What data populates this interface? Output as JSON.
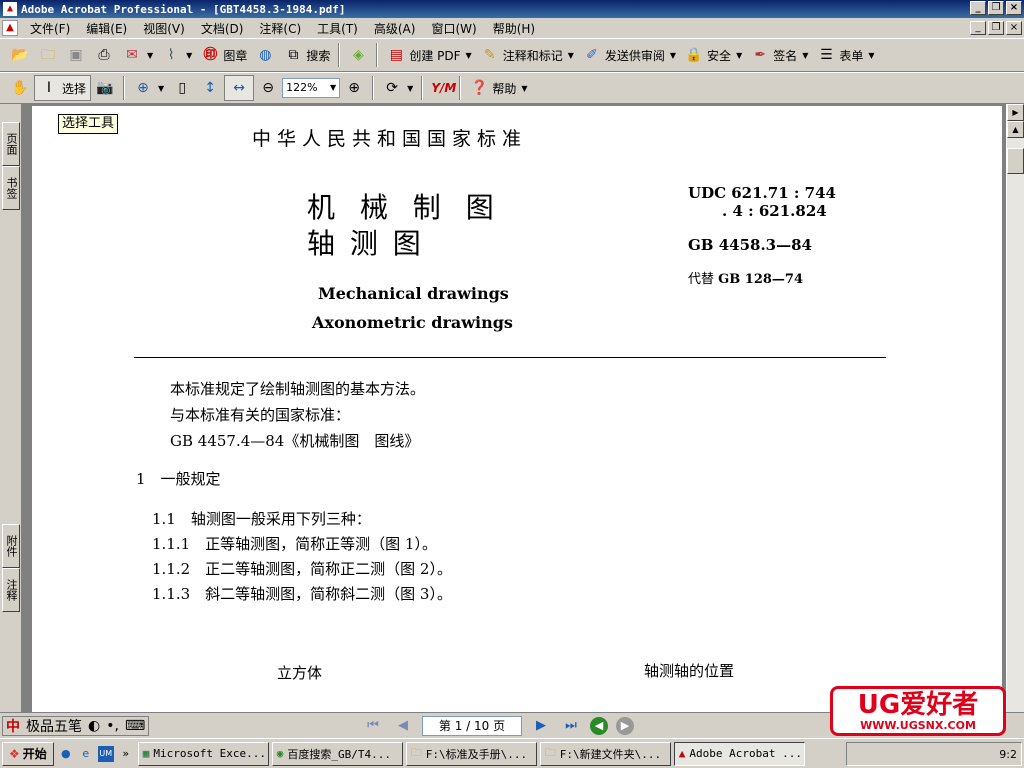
{
  "window": {
    "title": "Adobe Acrobat Professional - [GBT4458.3-1984.pdf]"
  },
  "menu": [
    "文件(F)",
    "编辑(E)",
    "视图(V)",
    "文档(D)",
    "注释(C)",
    "工具(T)",
    "高级(A)",
    "窗口(W)",
    "帮助(H)"
  ],
  "toolbar1": {
    "stamp": "图章",
    "search": "搜索",
    "create_pdf": "创建 PDF",
    "comment": "注释和标记",
    "review": "发送供审阅",
    "security": "安全",
    "sign": "签名",
    "forms": "表单"
  },
  "toolbar2": {
    "select": "选择",
    "zoom": "122%",
    "help": "帮助"
  },
  "left_tabs": {
    "pages": "页面",
    "bookmarks": "书签",
    "attachments": "附件",
    "comments": "注释"
  },
  "tooltip": "选择工具",
  "document": {
    "header": "中华人民共和国国家标准",
    "title1": "机 械 制 图",
    "title2": "轴     测     图",
    "en_title1": "Mechanical drawings",
    "en_title2": "Axonometric drawings",
    "udc1": "UDC 621.71 : 744",
    "udc2": ". 4 : 621.824",
    "gb": "GB 4458.3—84",
    "replace_prefix": "代替",
    "replace_code": "GB 128—74",
    "intro1": "本标准规定了绘制轴测图的基本方法。",
    "intro2": "与本标准有关的国家标准：",
    "intro3": "GB 4457.4—84《机械制图　图线》",
    "s1": "1　一般规定",
    "s11": "1.1　轴测图一般采用下列三种：",
    "s111": "1.1.1　正等轴测图，简称正等测（图 1）。",
    "s112": "1.1.2　正二等轴测图，简称正二测（图 2）。",
    "s113": "1.1.3　斜二等轴测图，简称斜二测（图 3）。",
    "fig_left": "立方体",
    "fig_right": "轴测轴的位置"
  },
  "statusbar": {
    "ime_brand": "中",
    "ime_name": "极品五笔",
    "page_indicator": "第 1 / 10 页"
  },
  "watermark": {
    "main": "UG爱好者",
    "url": "WWW.UGSNX.COM"
  },
  "taskbar": {
    "start": "开始",
    "tasks": [
      "Microsoft Exce...",
      "百度搜索_GB/T4...",
      "F:\\标准及手册\\...",
      "F:\\新建文件夹\\...",
      "Adobe Acrobat ..."
    ],
    "clock": "9:2"
  }
}
